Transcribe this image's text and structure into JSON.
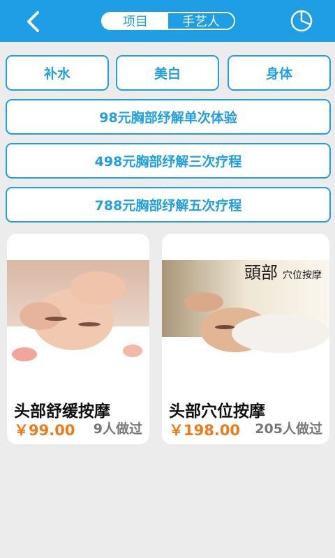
{
  "header": {
    "tabs": [
      {
        "label": "项目",
        "active": true
      },
      {
        "label": "手艺人",
        "active": false
      }
    ],
    "back_icon": "chevron-left-icon",
    "right_icon": "pie-chart-icon"
  },
  "categories": [
    "补水",
    "美白",
    "身体"
  ],
  "packages": [
    "98元胸部纾解单次体验",
    "498元胸部纾解三次疗程",
    "788元胸部纾解五次疗程"
  ],
  "products": [
    {
      "title": "头部舒缓按摩",
      "price": "￥99.00",
      "count": "9人做过"
    },
    {
      "title": "头部穴位按摩",
      "price": "￥198.00",
      "count": "205人做过",
      "image_text_big": "頭部",
      "image_text_small": "穴位按摩"
    }
  ],
  "colors": {
    "accent": "#1f9ee6",
    "price": "#ee7a1a",
    "background": "#ececec"
  }
}
